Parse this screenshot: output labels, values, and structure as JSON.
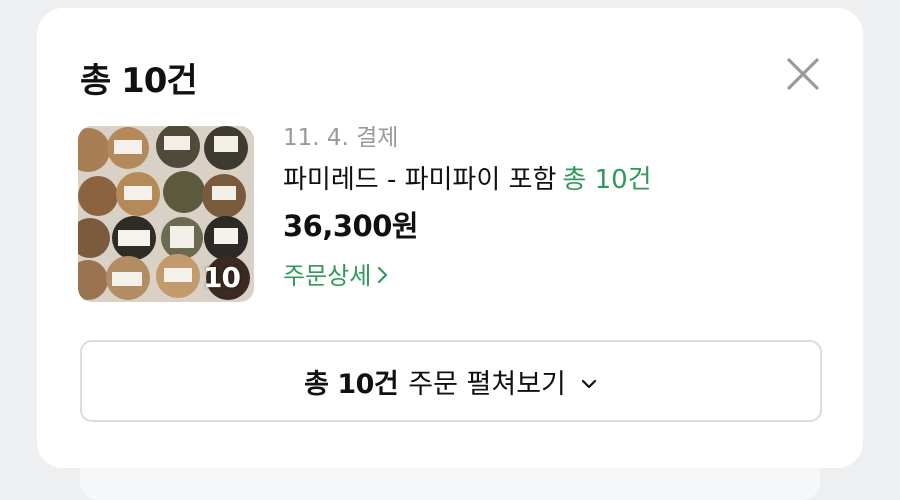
{
  "card": {
    "title": "총 10건"
  },
  "order": {
    "pay_date": "11. 4. 결제",
    "product_name": "파미레드 - 파미파이 포함",
    "product_count": "총 10건",
    "price": "36,300원",
    "detail_link": "주문상세",
    "thumbnail_count": "10"
  },
  "expand_button": {
    "count_label": "총 10건",
    "label": "주문 펼쳐보기"
  },
  "colors": {
    "accent_green": "#2f9a5a",
    "muted_gray": "#9a9a9a",
    "close_icon": "#9a9a9a"
  },
  "icons": {
    "close": "close-icon",
    "chevron_right": "chevron-right-icon",
    "chevron_down": "chevron-down-icon"
  }
}
